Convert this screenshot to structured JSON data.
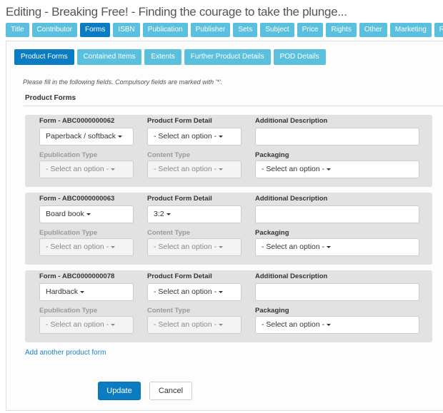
{
  "page_title": "Editing - Breaking Free! - Finding the courage to take the plunge...",
  "tabs": [
    "Title",
    "Contributor",
    "Forms",
    "ISBN",
    "Publication",
    "Publisher",
    "Sets",
    "Subject",
    "Price",
    "Rights",
    "Other",
    "Marketing",
    "Rela"
  ],
  "active_tab": "Forms",
  "subtabs": [
    "Product Forms",
    "Contained Items",
    "Extents",
    "Further Product Details",
    "POD Details"
  ],
  "active_subtab": "Product Forms",
  "hint": "Please fill in the following fields. Compulsory fields are marked with '*'.",
  "section_heading": "Product Forms",
  "labels": {
    "product_form_detail": "Product Form Detail",
    "additional_description": "Additional Description",
    "epublication_type": "Epublication Type",
    "content_type": "Content Type",
    "packaging": "Packaging"
  },
  "forms": [
    {
      "form_label": "Form - ABC0000000062",
      "form": "Paperback / softback",
      "detail": "- Select an option -",
      "additional_description": "",
      "epublication_type": "- Select an option -",
      "content_type": "- Select an option -",
      "packaging": "- Select an option -"
    },
    {
      "form_label": "Form - ABC0000000063",
      "form": "Board book",
      "detail": "3:2",
      "additional_description": "",
      "epublication_type": "- Select an option -",
      "content_type": "- Select an option -",
      "packaging": "- Select an option -"
    },
    {
      "form_label": "Form - ABC0000000078",
      "form": "Hardback",
      "detail": "- Select an option -",
      "additional_description": "",
      "epublication_type": "- Select an option -",
      "content_type": "- Select an option -",
      "packaging": "- Select an option -"
    }
  ],
  "add_link": "Add another product form",
  "buttons": {
    "update": "Update",
    "cancel": "Cancel"
  },
  "colors": {
    "tab": "#5bc0de",
    "tab_active": "#0b7bc2",
    "block_bg": "#e2e2e2",
    "link": "#1a7fc4"
  }
}
